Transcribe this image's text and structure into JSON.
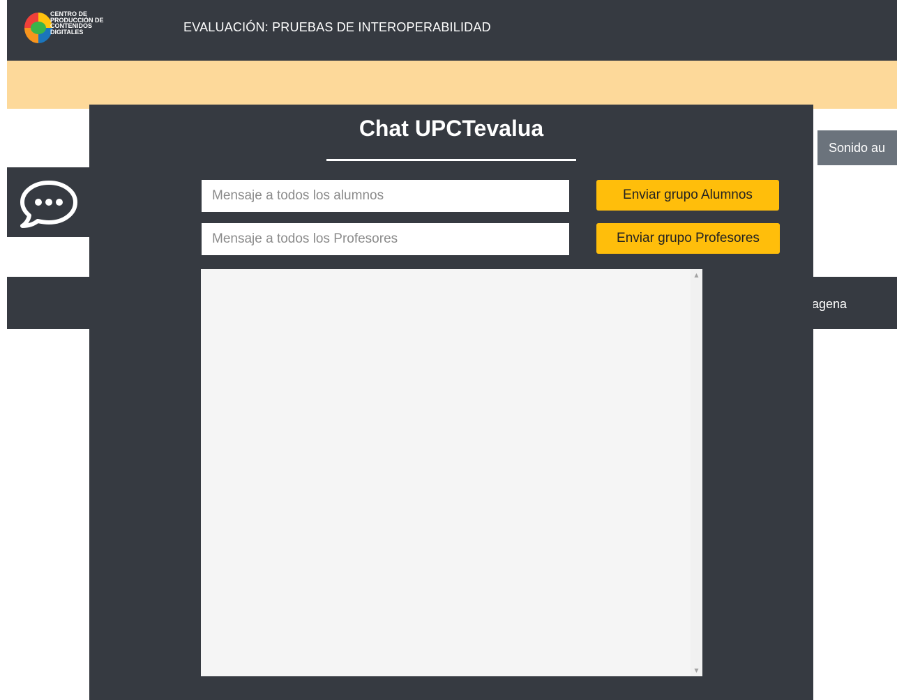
{
  "header": {
    "logo_lines": [
      "CENTRO DE",
      "PRODUCCIÓN DE",
      "CONTENIDOS",
      "DIGITALES"
    ],
    "title": "EVALUACIÓN: PRUEBAS DE INTEROPERABILIDAD"
  },
  "background": {
    "sound_button_label": "Sonido au",
    "footer_text": "agena"
  },
  "chat": {
    "title": "Chat UPCTevalua",
    "students_input_placeholder": "Mensaje a todos los alumnos",
    "teachers_input_placeholder": "Mensaje a todos los Profesores",
    "send_students_label": "Enviar grupo Alumnos",
    "send_teachers_label": "Enviar grupo Profesores"
  },
  "icons": {
    "chat_toggle": "chat-bubble-icon",
    "logo": "cpcd-logo-icon"
  },
  "colors": {
    "dark": "#363a41",
    "notice": "#fdd99a",
    "accent": "#ffbe0b",
    "gray_button": "#6b737c"
  }
}
